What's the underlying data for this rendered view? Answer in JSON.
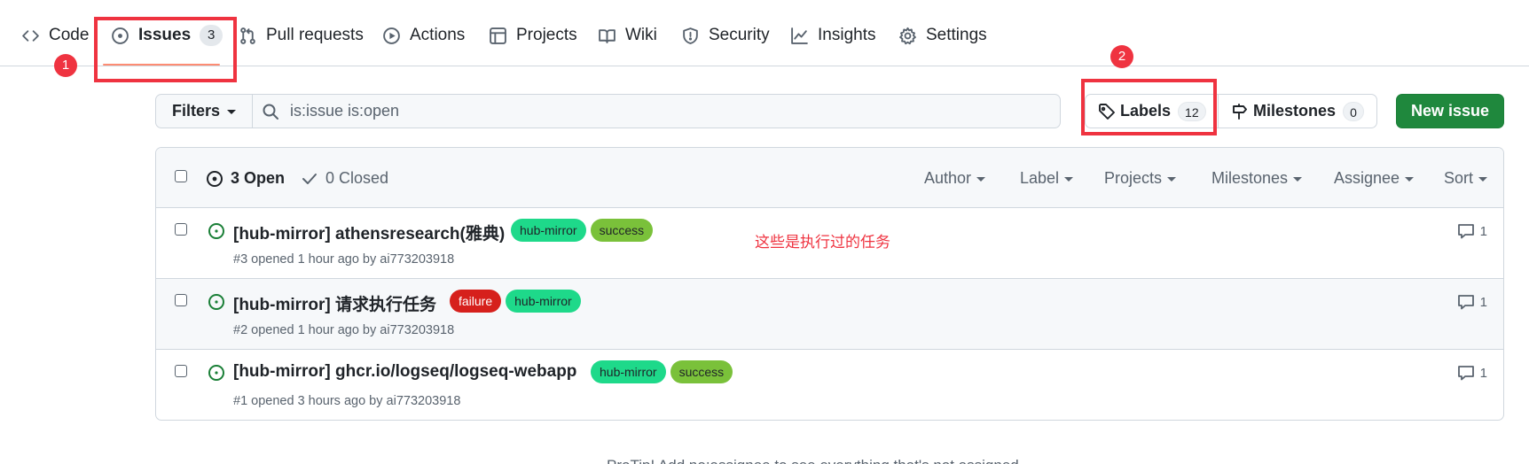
{
  "repo_nav": {
    "items": [
      {
        "label": "Code",
        "icon": "code-icon"
      },
      {
        "label": "Issues",
        "icon": "issue-opened-icon",
        "counter": "3",
        "selected": true
      },
      {
        "label": "Pull requests",
        "icon": "git-pull-request-icon"
      },
      {
        "label": "Actions",
        "icon": "play-icon"
      },
      {
        "label": "Projects",
        "icon": "table-icon"
      },
      {
        "label": "Wiki",
        "icon": "book-icon"
      },
      {
        "label": "Security",
        "icon": "shield-icon"
      },
      {
        "label": "Insights",
        "icon": "graph-icon"
      },
      {
        "label": "Settings",
        "icon": "gear-icon"
      }
    ]
  },
  "annotations": {
    "badge1": "1",
    "badge2": "2",
    "note": "这些是执行过的任务",
    "color": "#ef3340"
  },
  "toolbar": {
    "filters_label": "Filters",
    "search_value": "is:issue is:open",
    "labels_label": "Labels",
    "labels_count": "12",
    "milestones_label": "Milestones",
    "milestones_count": "0",
    "new_issue_label": "New issue"
  },
  "list_header": {
    "open_label": "3 Open",
    "closed_label": "0 Closed",
    "filters": [
      "Author",
      "Label",
      "Projects",
      "Milestones",
      "Assignee",
      "Sort"
    ]
  },
  "issues": [
    {
      "title": "[hub-mirror] athensresearch(雅典)",
      "labels": [
        {
          "name": "hub-mirror",
          "bg": "#1ed98a",
          "fg": "#1f2328"
        },
        {
          "name": "success",
          "bg": "#7ac13a",
          "fg": "#1f2328"
        }
      ],
      "meta": "#3 opened 1 hour ago by ai773203918",
      "comments": "1"
    },
    {
      "title": "[hub-mirror] 请求执行任务",
      "labels": [
        {
          "name": "failure",
          "bg": "#d6201c",
          "fg": "#ffffff"
        },
        {
          "name": "hub-mirror",
          "bg": "#1ed98a",
          "fg": "#1f2328"
        }
      ],
      "meta": "#2 opened 1 hour ago by ai773203918",
      "comments": "1"
    },
    {
      "title": "[hub-mirror] ghcr.io/logseq/logseq-webapp",
      "labels": [
        {
          "name": "hub-mirror",
          "bg": "#1ed98a",
          "fg": "#1f2328"
        },
        {
          "name": "success",
          "bg": "#7ac13a",
          "fg": "#1f2328"
        }
      ],
      "meta": "#1 opened 3 hours ago by ai773203918",
      "comments": "1"
    }
  ],
  "footer": {
    "protip": "ProTip! Add no:assignee to see everything that's not assigned."
  }
}
